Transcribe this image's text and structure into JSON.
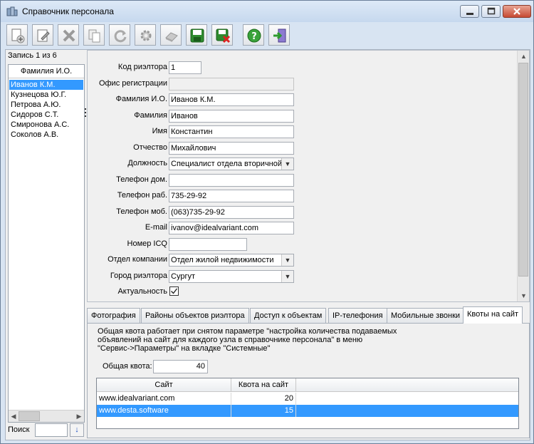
{
  "window": {
    "title": "Справочник персонала"
  },
  "toolbar": {
    "buttons": [
      {
        "icon": "add-record-icon"
      },
      {
        "icon": "edit-icon"
      },
      {
        "icon": "delete-icon"
      },
      {
        "icon": "copy-icon"
      },
      {
        "icon": "refresh-icon"
      },
      {
        "icon": "settings-icon"
      },
      {
        "icon": "eraser-icon"
      },
      {
        "icon": "save-icon"
      },
      {
        "icon": "save-close-icon"
      },
      {
        "icon": "help-icon"
      },
      {
        "icon": "exit-icon"
      }
    ]
  },
  "records": {
    "counter": "Запись 1 из 6",
    "column_header": "Фамилия И.О.",
    "items": [
      "Иванов К.М.",
      "Кузнецова Ю.Г.",
      "Петрова А.Ю.",
      "Сидоров С.Т.",
      "Смиронова А.С.",
      "Соколов А.В."
    ],
    "selected_index": 0
  },
  "search": {
    "label": "Поиск",
    "value": ""
  },
  "form": {
    "realtor_code": {
      "label": "Код риэлтора",
      "value": "1"
    },
    "office": {
      "label": "Офис регистрации",
      "value": ""
    },
    "full_name": {
      "label": "Фамилия И.О.",
      "value": "Иванов К.М."
    },
    "surname": {
      "label": "Фамилия",
      "value": "Иванов"
    },
    "first_name": {
      "label": "Имя",
      "value": "Константин"
    },
    "patronymic": {
      "label": "Отчество",
      "value": "Михайлович"
    },
    "position": {
      "label": "Должность",
      "value": "Специалист отдела вторичной"
    },
    "phone_home": {
      "label": "Телефон дом.",
      "value": ""
    },
    "phone_work": {
      "label": "Телефон раб.",
      "value": "735-29-92"
    },
    "phone_mobile": {
      "label": "Телефон моб.",
      "value": "(063)735-29-92"
    },
    "email": {
      "label": "E-mail",
      "value": "ivanov@idealvariant.com"
    },
    "icq": {
      "label": "Номер ICQ",
      "value": ""
    },
    "department": {
      "label": "Отдел компании",
      "value": "Отдел жилой недвижимости"
    },
    "city": {
      "label": "Город риэлтора",
      "value": "Сургут"
    },
    "active": {
      "label": "Актуальность",
      "checked": true
    }
  },
  "tabs": [
    {
      "label": "Фотография"
    },
    {
      "label": "Районы объектов риэлтора"
    },
    {
      "label": "Доступ к объектам"
    },
    {
      "label": "IP-телефония"
    },
    {
      "label": "Мобильные звонки"
    },
    {
      "label": "Квоты на сайт",
      "active": true
    }
  ],
  "quota_tab": {
    "info_lines": [
      "Общая квота работает при снятом параметре \"настройка количества подаваемых",
      "объявлений на сайт для каждого узла в справочнике персонала\" в меню",
      "\"Сервис->Параметры\" на вкладке \"Системные\""
    ],
    "total_label": "Общая квота:",
    "total_value": "40",
    "grid": {
      "columns": [
        "Сайт",
        "Квота на сайт"
      ],
      "rows": [
        {
          "site": "www.idealvariant.com",
          "quota": "20"
        },
        {
          "site": "www.desta.software",
          "quota": "15"
        }
      ],
      "selected_row": 1
    }
  }
}
